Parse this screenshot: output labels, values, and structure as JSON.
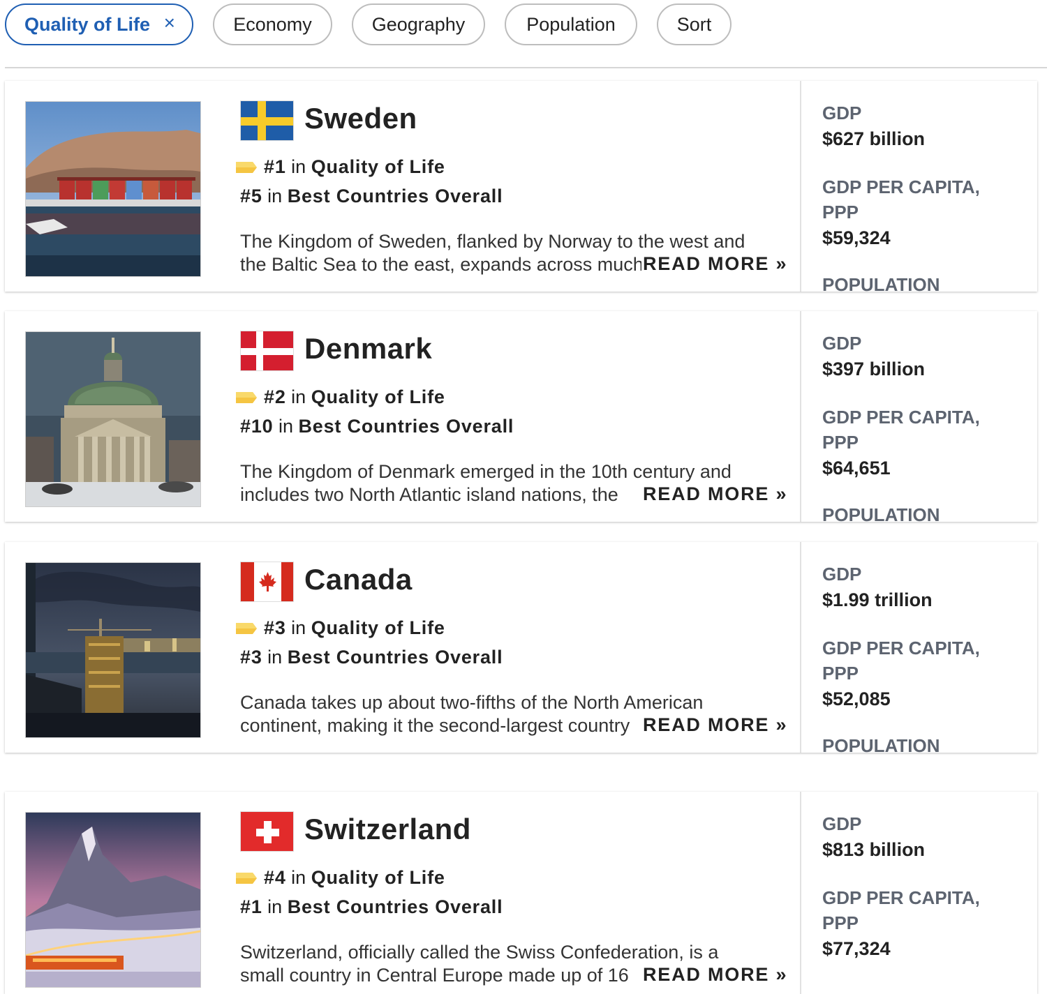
{
  "filters": {
    "active": {
      "label": "Quality of Life",
      "remove_icon": "×"
    },
    "chips": [
      "Economy",
      "Geography",
      "Population",
      "Sort"
    ]
  },
  "stat_labels": {
    "gdp": "GDP",
    "gdp_per_capita": "GDP PER CAPITA, PPP",
    "population": "POPULATION"
  },
  "rank_words": {
    "in": "in",
    "read_more": "READ MORE »"
  },
  "countries": [
    {
      "name": "Sweden",
      "rank_primary": "#1",
      "rank_primary_label": "Quality of Life",
      "rank_secondary": "#5",
      "rank_secondary_label": "Best Countries Overall",
      "desc_line1": "The Kingdom of Sweden, flanked by Norway to the west and",
      "desc_line2": "the Baltic Sea to the east, expands across much",
      "gdp": "$627 billion",
      "gdp_per_capita": "$59,324"
    },
    {
      "name": "Denmark",
      "rank_primary": "#2",
      "rank_primary_label": "Quality of Life",
      "rank_secondary": "#10",
      "rank_secondary_label": "Best Countries Overall",
      "desc_line1": "The Kingdom of Denmark emerged in the 10th century and",
      "desc_line2": "includes two North Atlantic island nations, the",
      "gdp": "$397 billion",
      "gdp_per_capita": "$64,651"
    },
    {
      "name": "Canada",
      "rank_primary": "#3",
      "rank_primary_label": "Quality of Life",
      "rank_secondary": "#3",
      "rank_secondary_label": "Best Countries Overall",
      "desc_line1": "Canada takes up about two-fifths of the North American",
      "desc_line2": "continent, making it the second-largest country",
      "gdp": "$1.99 trillion",
      "gdp_per_capita": "$52,085"
    },
    {
      "name": "Switzerland",
      "rank_primary": "#4",
      "rank_primary_label": "Quality of Life",
      "rank_secondary": "#1",
      "rank_secondary_label": "Best Countries Overall",
      "desc_line1": "Switzerland, officially called the Swiss Confederation, is a",
      "desc_line2": "small country in Central Europe made up of 16",
      "gdp": "$813 billion",
      "gdp_per_capita": "$77,324"
    }
  ],
  "colors": {
    "accent": "#1f5fb3",
    "tag": "#f5c542",
    "stat_label": "#5d6470"
  }
}
